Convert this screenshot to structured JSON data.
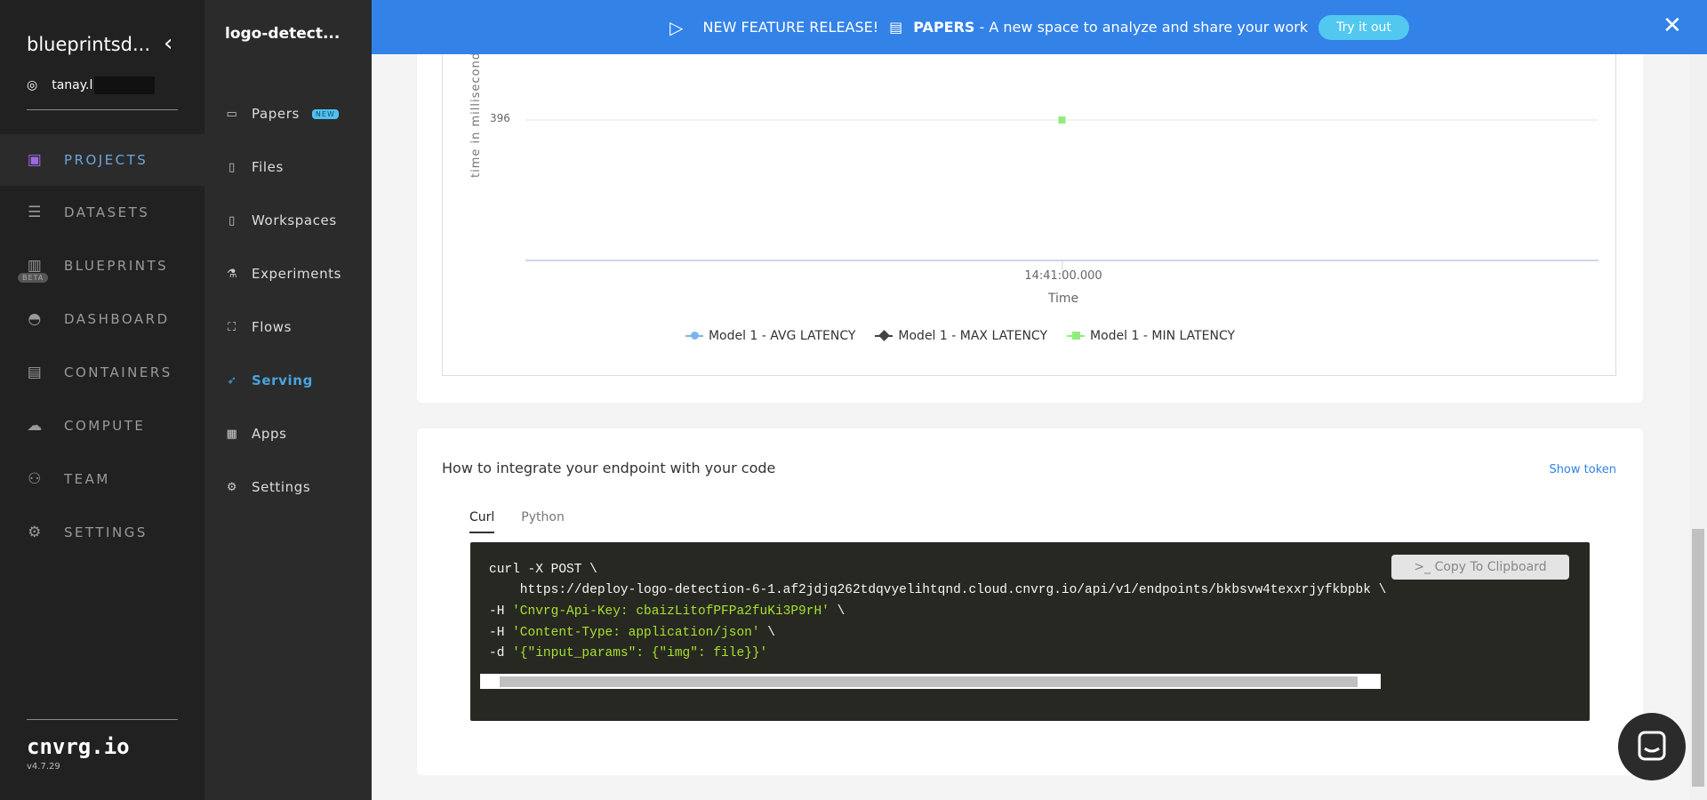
{
  "org": {
    "name": "blueprintsd...",
    "user": "tanay.l"
  },
  "main_nav": [
    {
      "label": "PROJECTS",
      "icon": "projects-icon",
      "active": true
    },
    {
      "label": "DATASETS",
      "icon": "database-icon"
    },
    {
      "label": "BLUEPRINTS",
      "icon": "books-icon",
      "badge": "BETA"
    },
    {
      "label": "DASHBOARD",
      "icon": "gauge-icon"
    },
    {
      "label": "CONTAINERS",
      "icon": "box-icon"
    },
    {
      "label": "COMPUTE",
      "icon": "cloud-icon"
    },
    {
      "label": "TEAM",
      "icon": "users-icon"
    },
    {
      "label": "SETTINGS",
      "icon": "gears-icon"
    }
  ],
  "brand": {
    "name": "cnvrg.io",
    "version": "v4.7.29"
  },
  "project": {
    "title": "logo-detect...",
    "nav": [
      {
        "label": "Papers",
        "badge": "NEW"
      },
      {
        "label": "Files"
      },
      {
        "label": "Workspaces"
      },
      {
        "label": "Experiments"
      },
      {
        "label": "Flows"
      },
      {
        "label": "Serving",
        "active": true
      },
      {
        "label": "Apps"
      },
      {
        "label": "Settings"
      }
    ]
  },
  "banner": {
    "prefix": "NEW FEATURE RELEASE!",
    "bold": "PAPERS",
    "text": " - A new space to analyze and share your work",
    "button": "Try it out",
    "color": "#3282e8"
  },
  "chart_data": {
    "type": "scatter",
    "ylabel": "time in milliseconds",
    "xlabel": "Time",
    "y_ticks": [
      "396"
    ],
    "x_ticks": [
      "14:41:00.000"
    ],
    "series": [
      {
        "name": "Model 1 - AVG LATENCY",
        "color": "#7cb5ec",
        "points": []
      },
      {
        "name": "Model 1 - MAX LATENCY",
        "color": "#434348",
        "points": []
      },
      {
        "name": "Model 1 - MIN LATENCY",
        "color": "#90ed7d",
        "points": [
          {
            "x": "14:41:00.000",
            "y": 396
          }
        ]
      }
    ],
    "legend": "bottom"
  },
  "integration": {
    "title": "How to integrate your endpoint with your code",
    "show_token": "Show token",
    "tabs": [
      "Curl",
      "Python"
    ],
    "copy": ">_ Copy To Clipboard",
    "code": {
      "l1": "curl -X POST \\",
      "l2": "    https://deploy-logo-detection-6-1.af2jdjq262tdqvyelihtqnd.cloud.cnvrg.io/api/v1/endpoints/bkbsvw4texxrjyfkbpbk \\",
      "l3a": "-H ",
      "l3b": "'Cnvrg-Api-Key: cbaizLitofPFPa2fuKi3P9rH'",
      "l3c": " \\",
      "l4a": "-H ",
      "l4b": "'Content-Type: application/json'",
      "l4c": " \\",
      "l5a": "-d ",
      "l5b": "'{\"input_params\": {\"img\": file}}'"
    }
  }
}
